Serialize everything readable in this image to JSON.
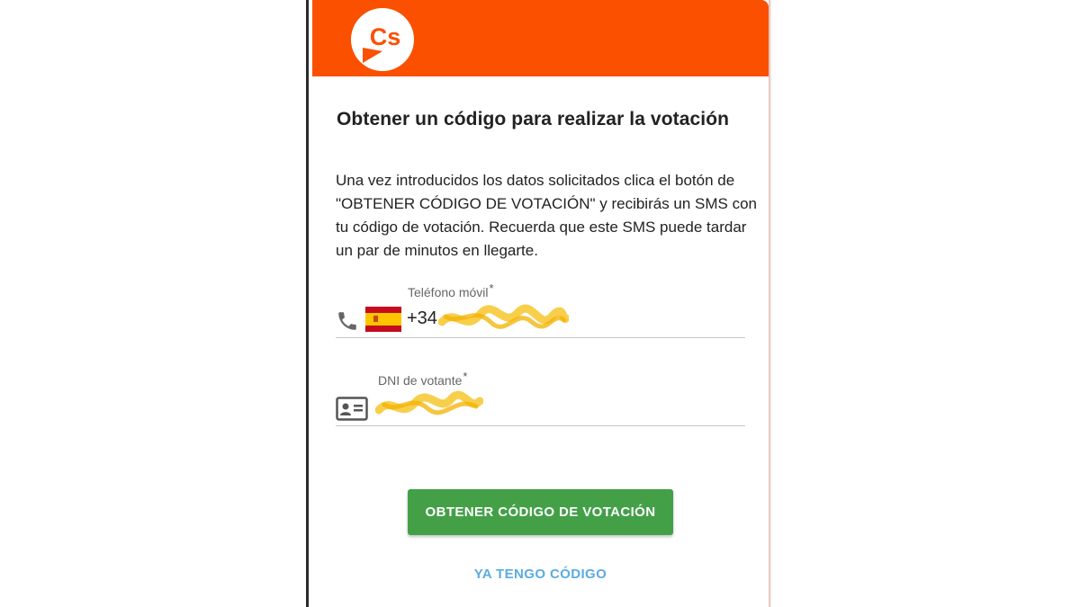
{
  "brand": {
    "logo_text": "Cs",
    "header_color": "#fa5000",
    "logo_color": "#fa5000"
  },
  "page": {
    "title": "Obtener un código para realizar la votación",
    "intro": "Una vez introducidos los datos solicitados clica el botón de \"OBTENER CÓDIGO DE VOTACIÓN\" y recibirás un SMS con tu código de votación. Recuerda que este SMS puede tardar un par de minutos en llegarte."
  },
  "form": {
    "phone": {
      "label": "Teléfono móvil",
      "required_mark": "*",
      "prefix": "+34",
      "icon": "phone-icon",
      "flag": "spain-flag-icon",
      "value_redacted": true
    },
    "dni": {
      "label": "DNI de votante",
      "required_mark": "*",
      "icon": "id-card-icon",
      "value_redacted": true
    }
  },
  "actions": {
    "primary_label": "OBTENER CÓDIGO DE VOTACIÓN",
    "primary_color": "#43a047",
    "secondary_label": "YA TENGO CÓDIGO",
    "secondary_color": "#5bace0"
  }
}
